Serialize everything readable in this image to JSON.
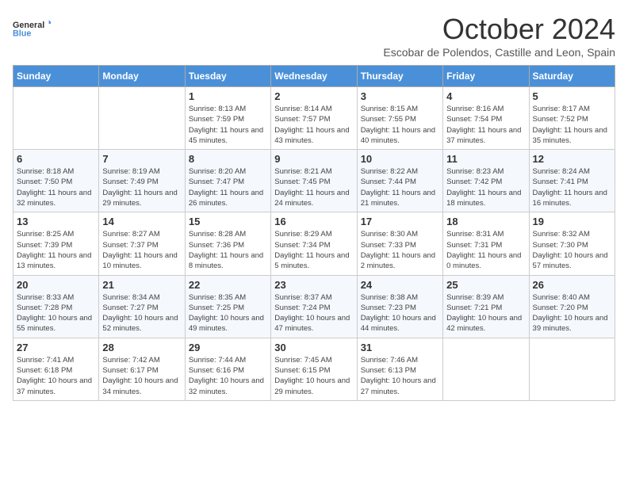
{
  "header": {
    "logo_line1": "General",
    "logo_line2": "Blue",
    "month_title": "October 2024",
    "subtitle": "Escobar de Polendos, Castille and Leon, Spain"
  },
  "days_of_week": [
    "Sunday",
    "Monday",
    "Tuesday",
    "Wednesday",
    "Thursday",
    "Friday",
    "Saturday"
  ],
  "weeks": [
    [
      {
        "day": "",
        "sunrise": "",
        "sunset": "",
        "daylight": ""
      },
      {
        "day": "",
        "sunrise": "",
        "sunset": "",
        "daylight": ""
      },
      {
        "day": "1",
        "sunrise": "Sunrise: 8:13 AM",
        "sunset": "Sunset: 7:59 PM",
        "daylight": "Daylight: 11 hours and 45 minutes."
      },
      {
        "day": "2",
        "sunrise": "Sunrise: 8:14 AM",
        "sunset": "Sunset: 7:57 PM",
        "daylight": "Daylight: 11 hours and 43 minutes."
      },
      {
        "day": "3",
        "sunrise": "Sunrise: 8:15 AM",
        "sunset": "Sunset: 7:55 PM",
        "daylight": "Daylight: 11 hours and 40 minutes."
      },
      {
        "day": "4",
        "sunrise": "Sunrise: 8:16 AM",
        "sunset": "Sunset: 7:54 PM",
        "daylight": "Daylight: 11 hours and 37 minutes."
      },
      {
        "day": "5",
        "sunrise": "Sunrise: 8:17 AM",
        "sunset": "Sunset: 7:52 PM",
        "daylight": "Daylight: 11 hours and 35 minutes."
      }
    ],
    [
      {
        "day": "6",
        "sunrise": "Sunrise: 8:18 AM",
        "sunset": "Sunset: 7:50 PM",
        "daylight": "Daylight: 11 hours and 32 minutes."
      },
      {
        "day": "7",
        "sunrise": "Sunrise: 8:19 AM",
        "sunset": "Sunset: 7:49 PM",
        "daylight": "Daylight: 11 hours and 29 minutes."
      },
      {
        "day": "8",
        "sunrise": "Sunrise: 8:20 AM",
        "sunset": "Sunset: 7:47 PM",
        "daylight": "Daylight: 11 hours and 26 minutes."
      },
      {
        "day": "9",
        "sunrise": "Sunrise: 8:21 AM",
        "sunset": "Sunset: 7:45 PM",
        "daylight": "Daylight: 11 hours and 24 minutes."
      },
      {
        "day": "10",
        "sunrise": "Sunrise: 8:22 AM",
        "sunset": "Sunset: 7:44 PM",
        "daylight": "Daylight: 11 hours and 21 minutes."
      },
      {
        "day": "11",
        "sunrise": "Sunrise: 8:23 AM",
        "sunset": "Sunset: 7:42 PM",
        "daylight": "Daylight: 11 hours and 18 minutes."
      },
      {
        "day": "12",
        "sunrise": "Sunrise: 8:24 AM",
        "sunset": "Sunset: 7:41 PM",
        "daylight": "Daylight: 11 hours and 16 minutes."
      }
    ],
    [
      {
        "day": "13",
        "sunrise": "Sunrise: 8:25 AM",
        "sunset": "Sunset: 7:39 PM",
        "daylight": "Daylight: 11 hours and 13 minutes."
      },
      {
        "day": "14",
        "sunrise": "Sunrise: 8:27 AM",
        "sunset": "Sunset: 7:37 PM",
        "daylight": "Daylight: 11 hours and 10 minutes."
      },
      {
        "day": "15",
        "sunrise": "Sunrise: 8:28 AM",
        "sunset": "Sunset: 7:36 PM",
        "daylight": "Daylight: 11 hours and 8 minutes."
      },
      {
        "day": "16",
        "sunrise": "Sunrise: 8:29 AM",
        "sunset": "Sunset: 7:34 PM",
        "daylight": "Daylight: 11 hours and 5 minutes."
      },
      {
        "day": "17",
        "sunrise": "Sunrise: 8:30 AM",
        "sunset": "Sunset: 7:33 PM",
        "daylight": "Daylight: 11 hours and 2 minutes."
      },
      {
        "day": "18",
        "sunrise": "Sunrise: 8:31 AM",
        "sunset": "Sunset: 7:31 PM",
        "daylight": "Daylight: 11 hours and 0 minutes."
      },
      {
        "day": "19",
        "sunrise": "Sunrise: 8:32 AM",
        "sunset": "Sunset: 7:30 PM",
        "daylight": "Daylight: 10 hours and 57 minutes."
      }
    ],
    [
      {
        "day": "20",
        "sunrise": "Sunrise: 8:33 AM",
        "sunset": "Sunset: 7:28 PM",
        "daylight": "Daylight: 10 hours and 55 minutes."
      },
      {
        "day": "21",
        "sunrise": "Sunrise: 8:34 AM",
        "sunset": "Sunset: 7:27 PM",
        "daylight": "Daylight: 10 hours and 52 minutes."
      },
      {
        "day": "22",
        "sunrise": "Sunrise: 8:35 AM",
        "sunset": "Sunset: 7:25 PM",
        "daylight": "Daylight: 10 hours and 49 minutes."
      },
      {
        "day": "23",
        "sunrise": "Sunrise: 8:37 AM",
        "sunset": "Sunset: 7:24 PM",
        "daylight": "Daylight: 10 hours and 47 minutes."
      },
      {
        "day": "24",
        "sunrise": "Sunrise: 8:38 AM",
        "sunset": "Sunset: 7:23 PM",
        "daylight": "Daylight: 10 hours and 44 minutes."
      },
      {
        "day": "25",
        "sunrise": "Sunrise: 8:39 AM",
        "sunset": "Sunset: 7:21 PM",
        "daylight": "Daylight: 10 hours and 42 minutes."
      },
      {
        "day": "26",
        "sunrise": "Sunrise: 8:40 AM",
        "sunset": "Sunset: 7:20 PM",
        "daylight": "Daylight: 10 hours and 39 minutes."
      }
    ],
    [
      {
        "day": "27",
        "sunrise": "Sunrise: 7:41 AM",
        "sunset": "Sunset: 6:18 PM",
        "daylight": "Daylight: 10 hours and 37 minutes."
      },
      {
        "day": "28",
        "sunrise": "Sunrise: 7:42 AM",
        "sunset": "Sunset: 6:17 PM",
        "daylight": "Daylight: 10 hours and 34 minutes."
      },
      {
        "day": "29",
        "sunrise": "Sunrise: 7:44 AM",
        "sunset": "Sunset: 6:16 PM",
        "daylight": "Daylight: 10 hours and 32 minutes."
      },
      {
        "day": "30",
        "sunrise": "Sunrise: 7:45 AM",
        "sunset": "Sunset: 6:15 PM",
        "daylight": "Daylight: 10 hours and 29 minutes."
      },
      {
        "day": "31",
        "sunrise": "Sunrise: 7:46 AM",
        "sunset": "Sunset: 6:13 PM",
        "daylight": "Daylight: 10 hours and 27 minutes."
      },
      {
        "day": "",
        "sunrise": "",
        "sunset": "",
        "daylight": ""
      },
      {
        "day": "",
        "sunrise": "",
        "sunset": "",
        "daylight": ""
      }
    ]
  ]
}
